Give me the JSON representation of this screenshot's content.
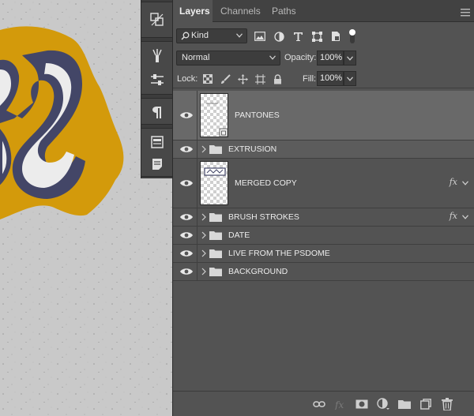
{
  "panel": {
    "tabs": [
      {
        "label": "Layers",
        "active": true
      },
      {
        "label": "Channels",
        "active": false
      },
      {
        "label": "Paths",
        "active": false
      }
    ],
    "menu_icon": "hamburger-menu-icon"
  },
  "filter": {
    "kind_label": "Kind",
    "icons": [
      "image-filter-icon",
      "adjustment-filter-icon",
      "type-filter-icon",
      "shape-filter-icon",
      "smart-object-filter-icon",
      "filter-toggle-icon"
    ]
  },
  "blend": {
    "mode": "Normal",
    "opacity_label": "Opacity:",
    "opacity_value": "100%"
  },
  "lock": {
    "label": "Lock:",
    "icons": [
      "lock-transparent-icon",
      "lock-image-icon",
      "lock-position-icon",
      "lock-artboard-icon",
      "lock-all-icon"
    ],
    "fill_label": "Fill:",
    "fill_value": "100%"
  },
  "layers": [
    {
      "name": "PANTONES",
      "type": "smart-object",
      "selected": true,
      "visible": true,
      "fx": false
    },
    {
      "name": "EXTRUSION",
      "type": "group",
      "selected": false,
      "visible": true,
      "fx": false
    },
    {
      "name": "MERGED COPY",
      "type": "layer",
      "selected": false,
      "visible": true,
      "fx": true
    },
    {
      "name": "BRUSH STROKES",
      "type": "group",
      "selected": false,
      "visible": true,
      "fx": true
    },
    {
      "name": "DATE",
      "type": "group",
      "selected": false,
      "visible": true,
      "fx": false
    },
    {
      "name": "LIVE FROM THE PSDOME",
      "type": "group",
      "selected": false,
      "visible": true,
      "fx": false
    },
    {
      "name": "BACKGROUND",
      "type": "group",
      "selected": false,
      "visible": true,
      "fx": false
    }
  ],
  "fx_label": "fx",
  "bottom_icons": [
    "link-layers-icon",
    "layer-style-icon",
    "layer-mask-icon",
    "adjustment-layer-icon",
    "new-group-icon",
    "new-layer-icon",
    "delete-layer-icon"
  ],
  "colors": {
    "panel_bg": "#535353",
    "selected_row": "#696969",
    "art_yellow": "#d39a0b",
    "art_navy": "#434667"
  }
}
